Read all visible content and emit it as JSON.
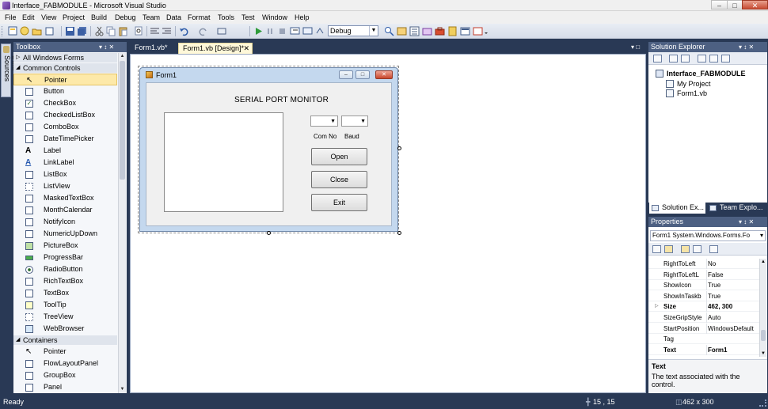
{
  "window": {
    "title": "Interface_FABMODULE - Microsoft Visual Studio",
    "min_glyph": "–",
    "max_glyph": "□",
    "close_glyph": "✕"
  },
  "menu": [
    "File",
    "Edit",
    "View",
    "Project",
    "Build",
    "Debug",
    "Team",
    "Data",
    "Format",
    "Tools",
    "Test",
    "Window",
    "Help"
  ],
  "toolbar": {
    "configuration": "Debug",
    "dropdown_glyph": "▼"
  },
  "left_strip": {
    "tab_label": "Data Sources"
  },
  "toolbox": {
    "title": "Toolbox",
    "controls": "▾ ↕ ✕",
    "groups": [
      {
        "label": "All Windows Forms",
        "arrow": "▷"
      },
      {
        "label": "Common Controls",
        "arrow": "◢"
      },
      {
        "label": "Containers",
        "arrow": "◢"
      }
    ],
    "common_items": [
      "Pointer",
      "Button",
      "CheckBox",
      "CheckedListBox",
      "ComboBox",
      "DateTimePicker",
      "Label",
      "LinkLabel",
      "ListBox",
      "ListView",
      "MaskedTextBox",
      "MonthCalendar",
      "NotifyIcon",
      "NumericUpDown",
      "PictureBox",
      "ProgressBar",
      "RadioButton",
      "RichTextBox",
      "TextBox",
      "ToolTip",
      "TreeView",
      "WebBrowser"
    ],
    "container_items": [
      "Pointer",
      "FlowLayoutPanel",
      "GroupBox",
      "Panel"
    ],
    "selected_item": "Pointer",
    "scroll_up": "▲",
    "scroll_down": "▼"
  },
  "document_tabs": [
    {
      "label": "Form1.vb*",
      "active": false
    },
    {
      "label": "Form1.vb [Design]*",
      "active": true
    }
  ],
  "document_tab_close": "✕",
  "document_pins": "▾ □",
  "designer": {
    "form_title": "Form1",
    "heading": "SERIAL PORT MONITOR",
    "com_label": "Com No",
    "baud_label": "Baud",
    "combo_glyph": "▼",
    "buttons": {
      "open": "Open",
      "close": "Close",
      "exit": "Exit"
    },
    "window_buttons": {
      "min": "–",
      "max": "□",
      "close": "✕"
    }
  },
  "solution_explorer": {
    "title": "Solution Explorer",
    "controls": "▾ ↕ ✕",
    "project": "Interface_FABMODULE",
    "items": [
      "My Project",
      "Form1.vb"
    ],
    "tabs": [
      "Solution Ex...",
      "Team Explo..."
    ]
  },
  "properties": {
    "title": "Properties",
    "controls": "▾ ↕ ✕",
    "object": "Form1 System.Windows.Forms.Fo",
    "object_dropdown": "▾",
    "rows": [
      {
        "name": "RightToLeft",
        "value": "No",
        "bold": false,
        "expand": ""
      },
      {
        "name": "RightToLeftL",
        "value": "False",
        "bold": false,
        "expand": ""
      },
      {
        "name": "ShowIcon",
        "value": "True",
        "bold": false,
        "expand": ""
      },
      {
        "name": "ShowInTaskb",
        "value": "True",
        "bold": false,
        "expand": ""
      },
      {
        "name": "Size",
        "value": "462, 300",
        "bold": true,
        "expand": "▷"
      },
      {
        "name": "SizeGripStyle",
        "value": "Auto",
        "bold": false,
        "expand": ""
      },
      {
        "name": "StartPosition",
        "value": "WindowsDefault",
        "bold": false,
        "expand": ""
      },
      {
        "name": "Tag",
        "value": "",
        "bold": false,
        "expand": ""
      },
      {
        "name": "Text",
        "value": "Form1",
        "bold": true,
        "expand": ""
      }
    ],
    "desc_title": "Text",
    "desc_body": "The text associated with the control.",
    "scroll_up": "▲",
    "scroll_down": "▼"
  },
  "status": {
    "left": "Ready",
    "position": "15 , 15",
    "size": "462 x 300"
  },
  "colors": {
    "chrome": "#293955",
    "panel_header": "#4d6082",
    "selected_item": "#fde9a9",
    "active_tab": "#fff8d9"
  }
}
